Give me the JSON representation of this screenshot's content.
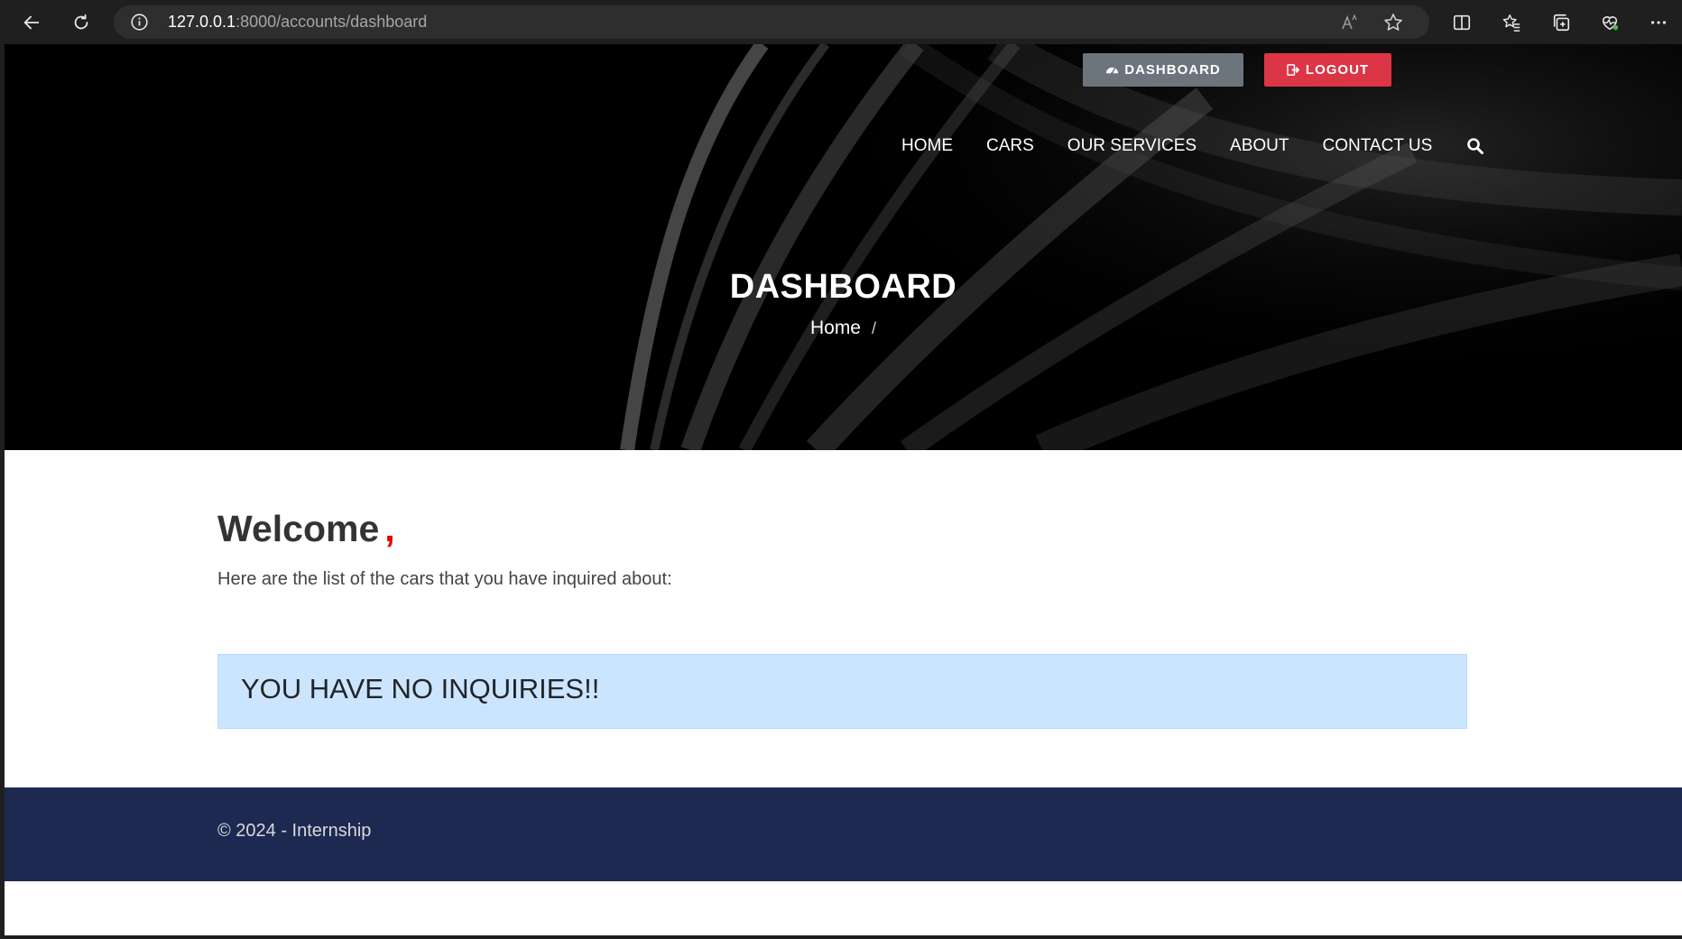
{
  "browser": {
    "url_host": "127.0.0.1",
    "url_path": ":8000/accounts/dashboard"
  },
  "header": {
    "dashboard_button": "DASHBOARD",
    "logout_button": "LOGOUT",
    "nav": [
      "HOME",
      "CARS",
      "OUR SERVICES",
      "ABOUT",
      "CONTACT US"
    ]
  },
  "hero": {
    "title": "DASHBOARD",
    "breadcrumb_home": "Home",
    "breadcrumb_sep": "/"
  },
  "content": {
    "welcome": "Welcome",
    "welcome_suffix": ",",
    "intro": "Here are the list of the cars that you have inquired about:",
    "alert": "YOU HAVE NO INQUIRIES!!"
  },
  "footer": {
    "copyright": "© 2024 - Internship"
  },
  "colors": {
    "logout": "#dc3545",
    "dashboard": "#6c757d",
    "alert_bg": "#cce5ff",
    "footer_bg": "#1e2952"
  }
}
